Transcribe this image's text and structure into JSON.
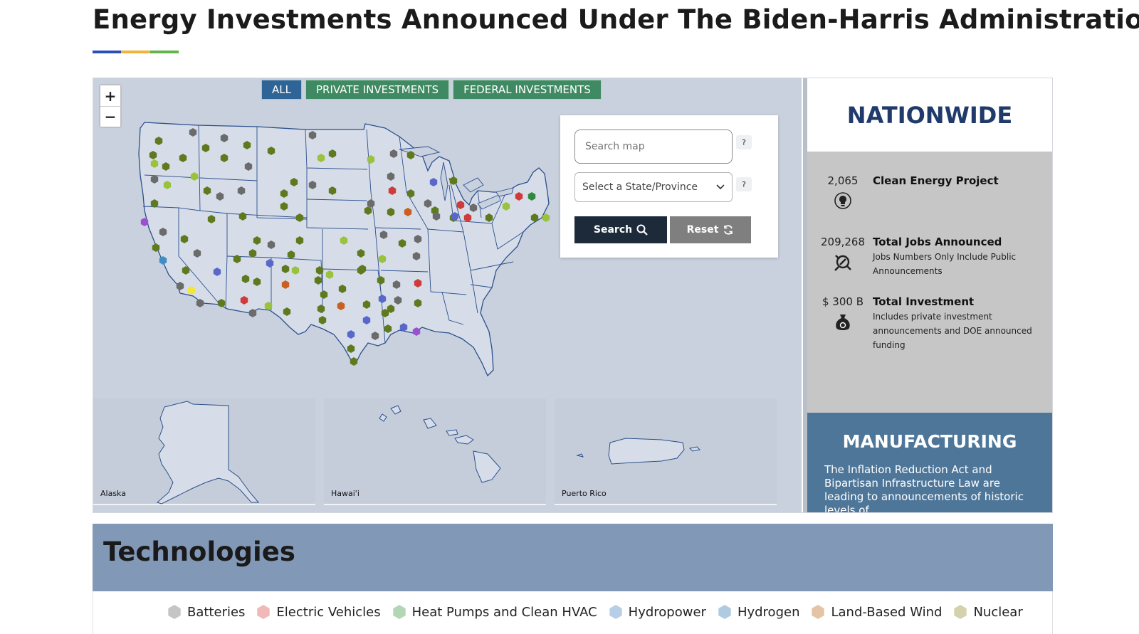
{
  "header": {
    "title": "Energy Investments Announced Under The Biden-Harris Administration",
    "rule_colors": [
      "#2c4fb6",
      "#f0b43c",
      "#62b54a"
    ]
  },
  "map": {
    "zoom_in": "+",
    "zoom_out": "−",
    "tabs": [
      {
        "label": "ALL",
        "active": true
      },
      {
        "label": "PRIVATE INVESTMENTS",
        "active": false
      },
      {
        "label": "FEDERAL INVESTMENTS",
        "active": false
      }
    ],
    "insets": [
      {
        "label": "Alaska"
      },
      {
        "label": "Hawai'i"
      },
      {
        "label": "Puerto Rico"
      }
    ],
    "marker_colors": {
      "gray": "#6b6b6b",
      "olive": "#5f7a1e",
      "lime": "#9ac23c",
      "blue": "#5868c8",
      "red": "#cf3a3a",
      "orange": "#c9601f",
      "purple": "#9b4fd1",
      "green": "#2f8a3a",
      "yellow": "#f2e63a",
      "teal": "#3d8fc4"
    }
  },
  "search": {
    "placeholder": "Search map",
    "help": "?",
    "state_select": "Select a State/Province",
    "search_button": "Search",
    "reset_button": "Reset"
  },
  "side": {
    "heading": "NATIONWIDE",
    "stats": [
      {
        "value": "2,065",
        "title": "Clean Energy Project",
        "note": ""
      },
      {
        "value": "209,268",
        "title": "Total Jobs Announced",
        "note": "Jobs Numbers Only Include Public Announcements"
      },
      {
        "value": "$ 300 B",
        "title": "Total Investment",
        "note": "Includes private investment announcements and DOE announced funding"
      }
    ],
    "manufacturing": {
      "title": "MANUFACTURING",
      "text": "The Inflation Reduction Act and Bipartisan Infrastructure Law are leading to announcements of historic levels of"
    }
  },
  "technologies": {
    "title": "Technologies",
    "items": [
      {
        "label": "Batteries",
        "color": "#c5c5c5"
      },
      {
        "label": "Electric Vehicles",
        "color": "#f0b8b8"
      },
      {
        "label": "Heat Pumps and Clean HVAC",
        "color": "#b3d6b3"
      },
      {
        "label": "Hydropower",
        "color": "#b7cfe6"
      },
      {
        "label": "Hydrogen",
        "color": "#aecbe0"
      },
      {
        "label": "Land-Based Wind",
        "color": "#e5c3a6"
      },
      {
        "label": "Nuclear",
        "color": "#d4d2ac"
      }
    ]
  }
}
